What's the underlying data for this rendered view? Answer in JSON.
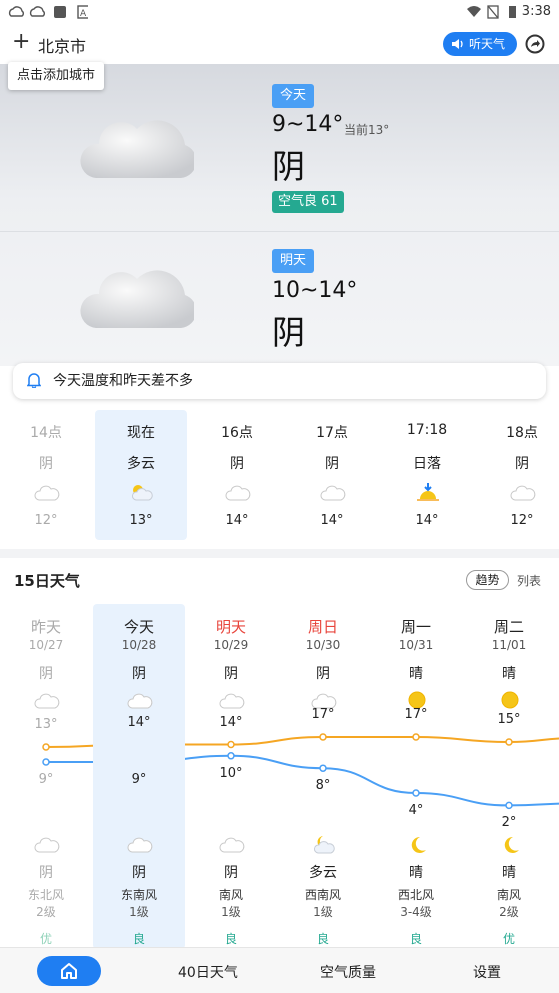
{
  "status_bar": {
    "time": "3:38"
  },
  "header": {
    "city": "北京市",
    "add_tooltip": "点击添加城市",
    "listen_label": "听天气"
  },
  "today": {
    "tag": "今天",
    "range": "9~14°",
    "now": "当前13°",
    "condition": "阴",
    "aqi": "空气良 61"
  },
  "tomorrow": {
    "tag": "明天",
    "range": "10~14°",
    "condition": "阴"
  },
  "notice": "今天温度和昨天差不多",
  "hourly": [
    {
      "time": "14点",
      "cond": "阴",
      "icon": "cloud-icon",
      "temp": "12°",
      "past": true
    },
    {
      "time": "现在",
      "cond": "多云",
      "icon": "partly-cloudy-icon",
      "temp": "13°",
      "selected": true
    },
    {
      "time": "16点",
      "cond": "阴",
      "icon": "cloud-icon",
      "temp": "14°"
    },
    {
      "time": "17点",
      "cond": "阴",
      "icon": "cloud-icon",
      "temp": "14°"
    },
    {
      "time": "17:18",
      "cond": "日落",
      "icon": "sunset-icon",
      "temp": "14°"
    },
    {
      "time": "18点",
      "cond": "阴",
      "icon": "cloud-icon",
      "temp": "12°"
    }
  ],
  "forecast15": {
    "title": "15日天气",
    "trend_label": "趋势",
    "list_label": "列表",
    "colors": {
      "high": "#f5a623",
      "low": "#4a9ff5"
    },
    "days": [
      {
        "name": "昨天",
        "date": "10/27",
        "day_cond": "阴",
        "day_icon": "cloud-icon",
        "high": 13,
        "low": 9,
        "night_icon": "cloud-icon",
        "night_cond": "阴",
        "wind": "东北风",
        "wind_level": "2级",
        "aqi": "优",
        "past": true
      },
      {
        "name": "今天",
        "date": "10/28",
        "day_cond": "阴",
        "day_icon": "cloud-icon",
        "high": 14,
        "low": 9,
        "night_icon": "cloud-icon",
        "night_cond": "阴",
        "wind": "东南风",
        "wind_level": "1级",
        "aqi": "良",
        "selected": true
      },
      {
        "name": "明天",
        "date": "10/29",
        "day_cond": "阴",
        "day_icon": "cloud-icon",
        "high": 14,
        "low": 10,
        "night_icon": "cloud-icon",
        "night_cond": "阴",
        "wind": "南风",
        "wind_level": "1级",
        "aqi": "良",
        "red": true
      },
      {
        "name": "周日",
        "date": "10/30",
        "day_cond": "阴",
        "day_icon": "cloud-icon",
        "high": 17,
        "low": 8,
        "night_icon": "partly-cloudy-night-icon",
        "night_cond": "多云",
        "wind": "西南风",
        "wind_level": "1级",
        "aqi": "良",
        "red": true
      },
      {
        "name": "周一",
        "date": "10/31",
        "day_cond": "晴",
        "day_icon": "sun-icon",
        "high": 17,
        "low": 4,
        "night_icon": "moon-icon",
        "night_cond": "晴",
        "wind": "西北风",
        "wind_level": "3-4级",
        "aqi": "良"
      },
      {
        "name": "周二",
        "date": "11/01",
        "day_cond": "晴",
        "day_icon": "sun-icon",
        "high": 15,
        "low": 2,
        "night_icon": "moon-icon",
        "night_cond": "晴",
        "wind": "南风",
        "wind_level": "2级",
        "aqi": "优"
      }
    ]
  },
  "bottom_nav": {
    "items": [
      "40日天气",
      "空气质量",
      "设置"
    ]
  }
}
